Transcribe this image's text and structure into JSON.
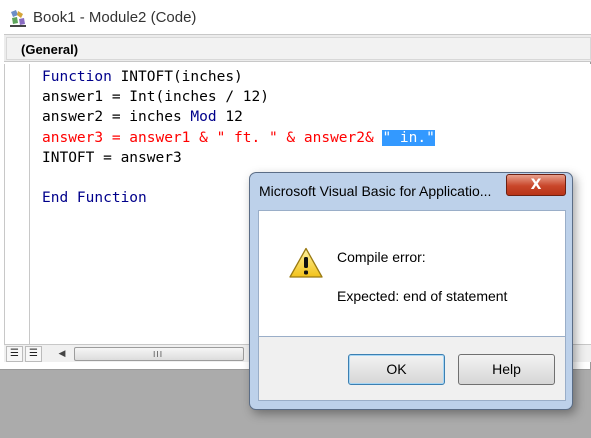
{
  "window": {
    "title": "Book1 - Module2 (Code)",
    "object_combo": "(General)"
  },
  "code_lines": [
    {
      "parts": [
        {
          "t": "Function",
          "c": "kw"
        },
        {
          "t": " INTOFT(inches)",
          "c": ""
        }
      ]
    },
    {
      "parts": [
        {
          "t": "answer1 = Int(inches / 12)",
          "c": ""
        }
      ]
    },
    {
      "parts": [
        {
          "t": "answer2 = inches ",
          "c": ""
        },
        {
          "t": "Mod",
          "c": "kw"
        },
        {
          "t": " 12",
          "c": ""
        }
      ]
    },
    {
      "parts": [
        {
          "t": "answer3 = answer1 & \" ft. \" & answer2& ",
          "c": "err"
        },
        {
          "t": "\" in.\"",
          "c": "sel"
        }
      ]
    },
    {
      "parts": [
        {
          "t": "INTOFT = answer3",
          "c": ""
        }
      ]
    },
    {
      "parts": [
        {
          "t": "",
          "c": ""
        }
      ]
    },
    {
      "parts": [
        {
          "t": "End Function",
          "c": "kw"
        }
      ]
    }
  ],
  "scrollbar": {
    "grip": "III"
  },
  "dialog": {
    "title": "Microsoft Visual Basic for Applicatio...",
    "close_label": "X",
    "message_line1": "Compile error:",
    "message_line2": "Expected: end of statement",
    "ok_label": "OK",
    "help_label": "Help",
    "icon": "warning-icon"
  },
  "colors": {
    "keyword": "#00008b",
    "error_line": "#ff0000",
    "selection": "#3399ff",
    "dialog_frame": "#bdd1ea",
    "close_button": "#c9462a"
  }
}
